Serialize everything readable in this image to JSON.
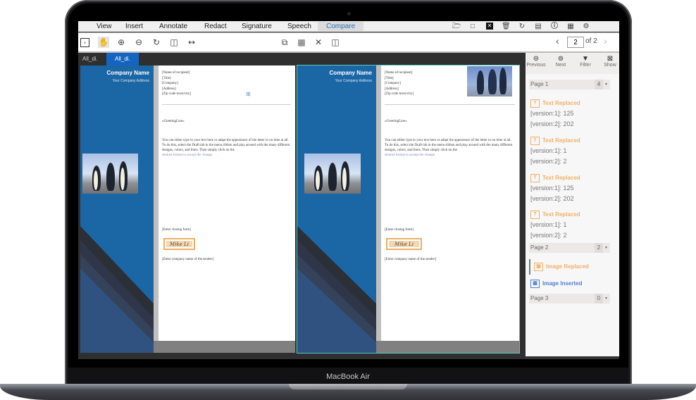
{
  "device": {
    "brand_label": "MacBook Air"
  },
  "menubar": {
    "items": [
      {
        "label": "View"
      },
      {
        "label": "Insert"
      },
      {
        "label": "Annotate"
      },
      {
        "label": "Redact"
      },
      {
        "label": "Signature"
      },
      {
        "label": "Speech"
      },
      {
        "label": "Compare",
        "active": true
      }
    ],
    "right_icons": [
      "open-folder-icon",
      "new-file-icon",
      "close-file-icon",
      "trash-icon",
      "sync-icon",
      "comment-icon",
      "info-icon",
      "document-properties-icon",
      "settings-icon"
    ]
  },
  "toolbar": {
    "left_icons": [
      "toggle-sidebar-icon",
      "hand-tool-icon",
      "zoom-in-icon",
      "zoom-out-icon",
      "rotate-icon",
      "fit-page-icon",
      "fit-width-icon"
    ],
    "center_icons": [
      "compare-files-icon",
      "compare-images-icon",
      "close-compare-icon",
      "side-by-side-icon"
    ],
    "pager": {
      "current_page": "2",
      "total_label": "of 2"
    }
  },
  "tabs": [
    {
      "label": "All_di.",
      "active": false
    },
    {
      "label": "All_di.",
      "active": true
    }
  ],
  "document": {
    "company_name": "Company Name",
    "company_address": "Your Company Address",
    "address_lines": [
      "[Name of recipient]",
      "[Title]",
      "[Company]",
      "[Address]",
      "[Zip code town/city]"
    ],
    "greeting": "«GreetingLine»",
    "body_line1": "You can either type in your text here or adapt the appearance of the letter to no time at all.",
    "body_line2": "To do this, select the Draft tab in the menu ribbon and play around with the many different designs, colors, and fonts. Then simply click on the",
    "body_link": "desired format to accept the change.",
    "closing": "[Enter closing form]",
    "signature_left": "Mike Li",
    "signature_right": "Mike Li",
    "sender": "[Enter company name of the sender]"
  },
  "panel": {
    "tools": [
      {
        "label": "Previous",
        "icon": "previous-icon"
      },
      {
        "label": "Next",
        "icon": "next-icon"
      },
      {
        "label": "Filter",
        "icon": "filter-icon"
      },
      {
        "label": "Show",
        "icon": "show-icon"
      }
    ],
    "pages": [
      {
        "label": "Page 1",
        "count": "4"
      },
      {
        "label": "Page 2",
        "count": "2"
      },
      {
        "label": "Page 3",
        "count": "0"
      }
    ],
    "changes": [
      {
        "type": "Text Replaced",
        "v1": "[version:1]: 125",
        "v2": "[version:2]: 202"
      },
      {
        "type": "Text Replaced",
        "v1": "[version:1]: 1",
        "v2": "[version:2]: 2"
      },
      {
        "type": "Text Replaced",
        "v1": "[version:1]: 125",
        "v2": "[version:2]: 202"
      },
      {
        "type": "Text Replaced",
        "v1": "[version:1]: 1",
        "v2": "[version:2]: 2"
      },
      {
        "type": "Image Replaced"
      },
      {
        "type": "Image Inserted"
      }
    ]
  },
  "colors": {
    "accent": "#1565c0",
    "text_replaced": "#f0b068",
    "image_inserted": "#4f7fcf",
    "doc_blue": "#1b67a6"
  }
}
